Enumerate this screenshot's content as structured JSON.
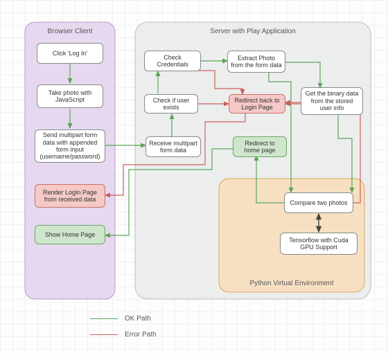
{
  "panels": {
    "browser": "Browser Client",
    "server": "Server with Play Application",
    "python": "Python Virtual Environment"
  },
  "nodes": {
    "click_login": "Click 'Log In'",
    "take_photo": "Take photo with JavaScript",
    "send_multipart": "Send multipart form data with appended form input (username/password)",
    "render_login": "Render LogIn Page from received data",
    "show_home": "Show Home Page",
    "check_credentials": "Check Credentials",
    "check_user": "Check if user exists",
    "receive_multipart": "Receive multipart form data",
    "extract_photo": "Extract Photo from the form data",
    "redirect_login": "Redirect back to Login Page",
    "redirect_home": "Redirect to home page",
    "get_binary": "Get the binary data from the stored user info",
    "compare_photos": "Compare two photos",
    "tensorflow": "Tensorflow with Cuda GPU Support"
  },
  "legend": {
    "ok": "OK Path",
    "error": "Error Path"
  },
  "colors": {
    "ok": "#5aa556",
    "error": "#cc5f5a",
    "black": "#444",
    "panel_browser_fill": "#e6d9ef",
    "panel_browser_stroke": "#b79bc9",
    "panel_server_fill": "#eceeee",
    "panel_server_stroke": "#b9bfc2",
    "panel_python_fill": "#f7e0c2",
    "panel_python_stroke": "#d9a45b"
  },
  "chart_data": {
    "type": "flowchart",
    "title": "Login flow across Browser Client, Play Server, and Python environment",
    "groups": [
      {
        "id": "browser",
        "label": "Browser Client"
      },
      {
        "id": "server",
        "label": "Server with Play Application"
      },
      {
        "id": "python",
        "label": "Python Virtual Environment",
        "parent": "server"
      }
    ],
    "nodes": [
      {
        "id": "click_login",
        "group": "browser",
        "kind": "step"
      },
      {
        "id": "take_photo",
        "group": "browser",
        "kind": "step"
      },
      {
        "id": "send_multipart",
        "group": "browser",
        "kind": "step"
      },
      {
        "id": "render_login",
        "group": "browser",
        "kind": "error"
      },
      {
        "id": "show_home",
        "group": "browser",
        "kind": "ok"
      },
      {
        "id": "check_credentials",
        "group": "server",
        "kind": "step"
      },
      {
        "id": "check_user",
        "group": "server",
        "kind": "step"
      },
      {
        "id": "receive_multipart",
        "group": "server",
        "kind": "step"
      },
      {
        "id": "extract_photo",
        "group": "server",
        "kind": "step"
      },
      {
        "id": "redirect_login",
        "group": "server",
        "kind": "error"
      },
      {
        "id": "redirect_home",
        "group": "server",
        "kind": "ok"
      },
      {
        "id": "get_binary",
        "group": "server",
        "kind": "step"
      },
      {
        "id": "compare_photos",
        "group": "python",
        "kind": "step"
      },
      {
        "id": "tensorflow",
        "group": "python",
        "kind": "step"
      }
    ],
    "edges": [
      {
        "from": "click_login",
        "to": "take_photo",
        "kind": "ok"
      },
      {
        "from": "take_photo",
        "to": "send_multipart",
        "kind": "ok"
      },
      {
        "from": "send_multipart",
        "to": "receive_multipart",
        "kind": "ok"
      },
      {
        "from": "receive_multipart",
        "to": "check_user",
        "kind": "ok"
      },
      {
        "from": "check_user",
        "to": "check_credentials",
        "kind": "ok"
      },
      {
        "from": "check_credentials",
        "to": "extract_photo",
        "kind": "ok"
      },
      {
        "from": "extract_photo",
        "to": "get_binary",
        "kind": "ok"
      },
      {
        "from": "get_binary",
        "to": "compare_photos",
        "kind": "ok"
      },
      {
        "from": "extract_photo",
        "to": "compare_photos",
        "kind": "ok"
      },
      {
        "from": "compare_photos",
        "to": "redirect_home",
        "kind": "ok"
      },
      {
        "from": "redirect_home",
        "to": "show_home",
        "kind": "ok"
      },
      {
        "from": "check_user",
        "to": "redirect_login",
        "kind": "error"
      },
      {
        "from": "check_credentials",
        "to": "redirect_login",
        "kind": "error"
      },
      {
        "from": "get_binary",
        "to": "redirect_login",
        "kind": "error"
      },
      {
        "from": "compare_photos",
        "to": "redirect_login",
        "kind": "error"
      },
      {
        "from": "redirect_login",
        "to": "render_login",
        "kind": "error"
      },
      {
        "from": "compare_photos",
        "to": "tensorflow",
        "kind": "both"
      },
      {
        "from": "tensorflow",
        "to": "compare_photos",
        "kind": "both"
      }
    ],
    "legend": [
      {
        "kind": "ok",
        "label": "OK Path"
      },
      {
        "kind": "error",
        "label": "Error Path"
      }
    ]
  }
}
